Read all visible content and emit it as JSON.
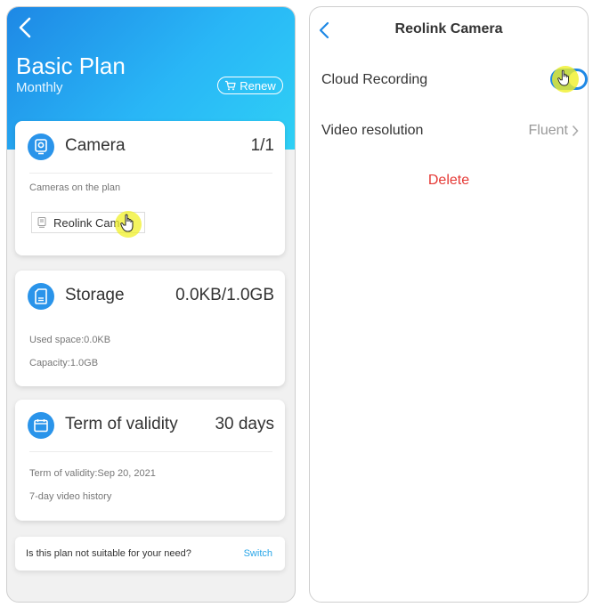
{
  "left_panel": {
    "plan_title": "Basic Plan",
    "plan_period": "Monthly",
    "renew_label": "Renew",
    "camera_card": {
      "title": "Camera",
      "count": "1/1",
      "subtitle": "Cameras on the plan",
      "camera_name": "Reolink Cam"
    },
    "storage_card": {
      "title": "Storage",
      "usage": "0.0KB/1.0GB",
      "used_space": "Used space:0.0KB",
      "capacity": "Capacity:1.0GB"
    },
    "validity_card": {
      "title": "Term of validity",
      "duration": "30 days",
      "term": "Term of validity:Sep 20, 2021",
      "history": "7-day video history"
    },
    "switch_row": {
      "question": "Is this plan not suitable for your need?",
      "switch_label": "Switch"
    }
  },
  "right_panel": {
    "title": "Reolink Camera",
    "cloud_recording_label": "Cloud Recording",
    "cloud_recording_enabled": true,
    "video_resolution_label": "Video resolution",
    "video_resolution_value": "Fluent",
    "delete_label": "Delete"
  },
  "colors": {
    "accent_blue": "#1e88e5",
    "gradient_end": "#2fd0f5",
    "delete_red": "#e53935",
    "link_blue": "#29a6e8"
  }
}
